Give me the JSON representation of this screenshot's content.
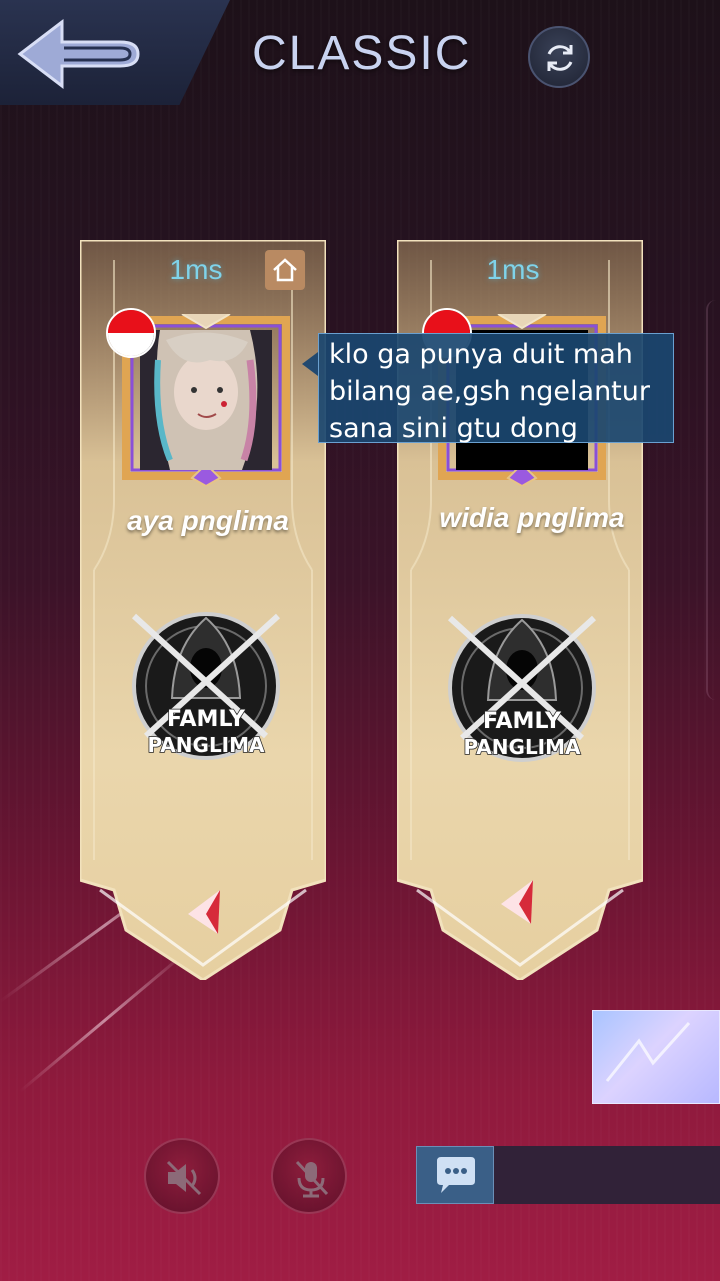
{
  "header": {
    "title": "CLASSIC",
    "back_icon": "back-arrow-icon",
    "refresh_icon": "refresh-icon"
  },
  "players": [
    {
      "ping": "1ms",
      "name": "aya pnglima",
      "flag": "indonesia-flag",
      "emblem_line1": "FAMLY",
      "emblem_line2": "PANGLIMA",
      "is_host": true
    },
    {
      "ping": "1ms",
      "name": "widia pnglima",
      "flag": "indonesia-flag",
      "emblem_line1": "FAMLY",
      "emblem_line2": "PANGLIMA",
      "is_host": false
    }
  ],
  "chat_bubble": {
    "lines": [
      "klo ga punya duit mah",
      "bilang ae,gsh ngelantur",
      "sana sini gtu dong"
    ]
  },
  "controls": {
    "speaker_icon": "speaker-muted-icon",
    "mic_icon": "mic-muted-icon",
    "chat_icon": "chat-icon"
  },
  "colors": {
    "ping": "#7fd3ea",
    "card_gold": "#e6cfa0",
    "chat_bg": "#1a4670",
    "background_bottom": "#a01d44"
  }
}
